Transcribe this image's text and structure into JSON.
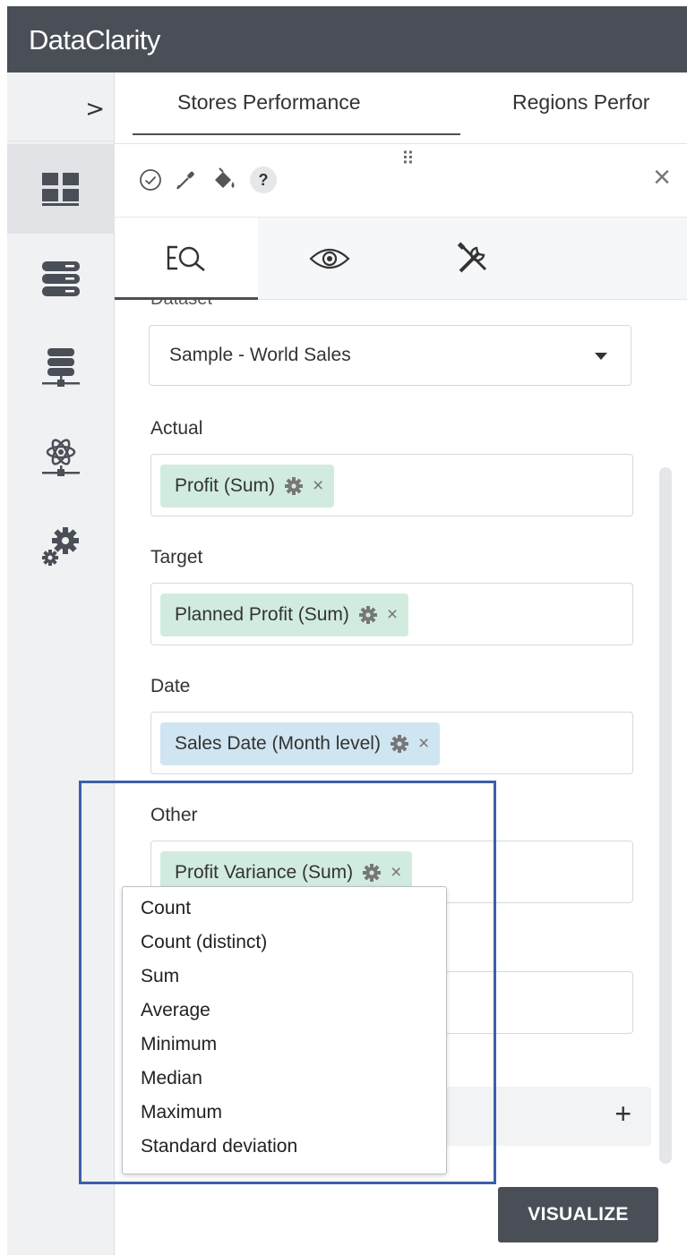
{
  "app": {
    "title": "DataClarity"
  },
  "tabs": [
    {
      "label": "Stores Performance"
    },
    {
      "label": "Regions Perfor"
    }
  ],
  "rail": {
    "expand_glyph": ">",
    "items": [
      {
        "icon": "dashboard-grid-icon"
      },
      {
        "icon": "database-stack-icon"
      },
      {
        "icon": "data-server-icon"
      },
      {
        "icon": "data-science-icon"
      },
      {
        "icon": "settings-gears-icon"
      }
    ]
  },
  "toolbar": {
    "icons": [
      "check-circle-icon",
      "eyedropper-icon",
      "paint-bucket-icon",
      "help-icon",
      "drag-grip-icon",
      "close-icon"
    ],
    "help_label": "?",
    "grip_label": "⠿",
    "close_label": "×"
  },
  "subtabs": [
    {
      "icon": "data-query-icon"
    },
    {
      "icon": "eye-icon"
    },
    {
      "icon": "tools-icon"
    }
  ],
  "form": {
    "dataset_label": "Dataset",
    "dataset_value": "Sample - World Sales",
    "fields": [
      {
        "label": "Actual",
        "chip": "Profit (Sum)",
        "chip_color": "#d1ecdf"
      },
      {
        "label": "Target",
        "chip": "Planned Profit (Sum)",
        "chip_color": "#d1ecdf"
      },
      {
        "label": "Date",
        "chip": "Sales Date (Month level)",
        "chip_color": "#cfe5f1"
      },
      {
        "label": "Other",
        "chip": "Profit Variance (Sum)",
        "chip_color": "#d1ecdf"
      }
    ],
    "chip_remove": "×",
    "add_label": "+"
  },
  "aggregation_menu": {
    "items": [
      "Count",
      "Count (distinct)",
      "Sum",
      "Average",
      "Minimum",
      "Median",
      "Maximum",
      "Standard deviation"
    ]
  },
  "actions": {
    "visualize_label": "VISUALIZE"
  },
  "colors": {
    "topbar": "#4a4f57",
    "chip_measure": "#d1ecdf",
    "chip_date": "#cfe5f1",
    "highlight_border": "#3b5faa",
    "button": "#4a4f57"
  }
}
